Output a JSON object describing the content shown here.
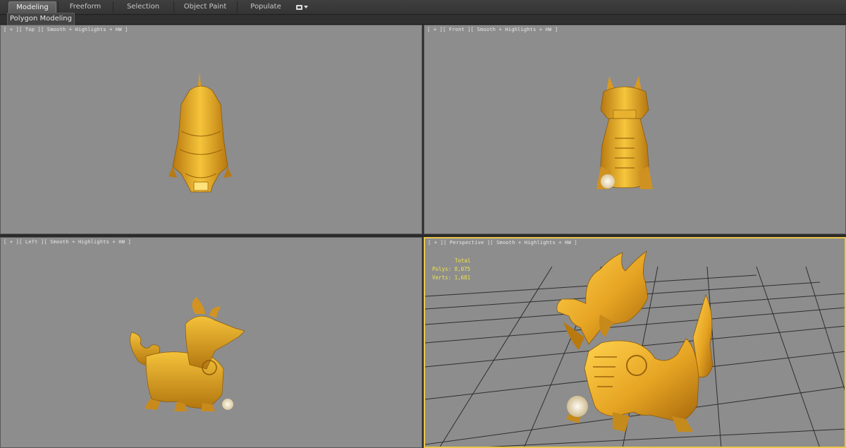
{
  "ribbon": {
    "tabs": [
      {
        "label": "Modeling",
        "active": true
      },
      {
        "label": "Freeform",
        "active": false
      },
      {
        "label": "Selection",
        "active": false
      },
      {
        "label": "Object Paint",
        "active": false
      },
      {
        "label": "Populate",
        "active": false
      }
    ],
    "more_icon": "display-dropdown-icon"
  },
  "subbar": {
    "panel_label": "Polygon Modeling"
  },
  "viewports": {
    "top": {
      "label": "[ + ][ Top ][ Smooth + Highlights + HW ]"
    },
    "front": {
      "label": "[ + ][ Front ][ Smooth + Highlights + HW ]"
    },
    "left": {
      "label": "[ + ][ Left ][ Smooth + Highlights + HW ]"
    },
    "perspective": {
      "label": "[ + ][ Perspective ][ Smooth + Highlights + HW ]",
      "active": true
    }
  },
  "stats": {
    "header": "Total",
    "polys_label": "Polys:",
    "polys_value": "8,075",
    "verts_label": "Verts:",
    "verts_value": "1,681"
  },
  "colors": {
    "viewport_bg": "#8d8d8d",
    "active_border": "#ecc64b",
    "model_gold": "#e0a21e",
    "stats_text": "#f0e44a"
  }
}
